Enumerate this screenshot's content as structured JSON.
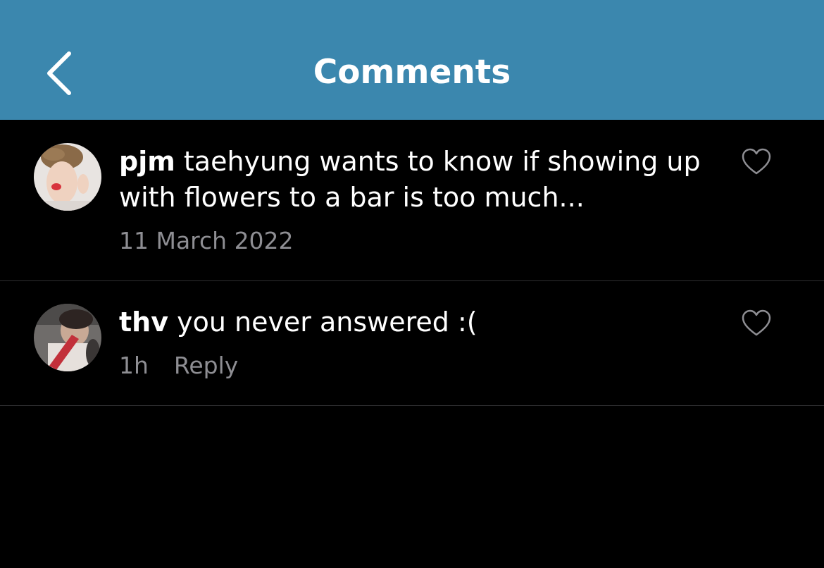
{
  "header": {
    "title": "Comments",
    "back_icon": "chevron-left-icon",
    "background_color": "#3b87ae"
  },
  "comments": [
    {
      "username": "pjm",
      "text": " taehyung wants to know if showing up with flowers to a bar is too much...",
      "timestamp": "11 March 2022",
      "like_icon": "heart-outline-icon"
    },
    {
      "username": "thv",
      "text": " you never answered :(",
      "timestamp": "1h",
      "reply_label": "Reply",
      "like_icon": "heart-outline-icon"
    }
  ],
  "colors": {
    "background": "#000000",
    "text": "#ffffff",
    "secondary_text": "#8e8e93",
    "divider": "#2e2e30"
  }
}
